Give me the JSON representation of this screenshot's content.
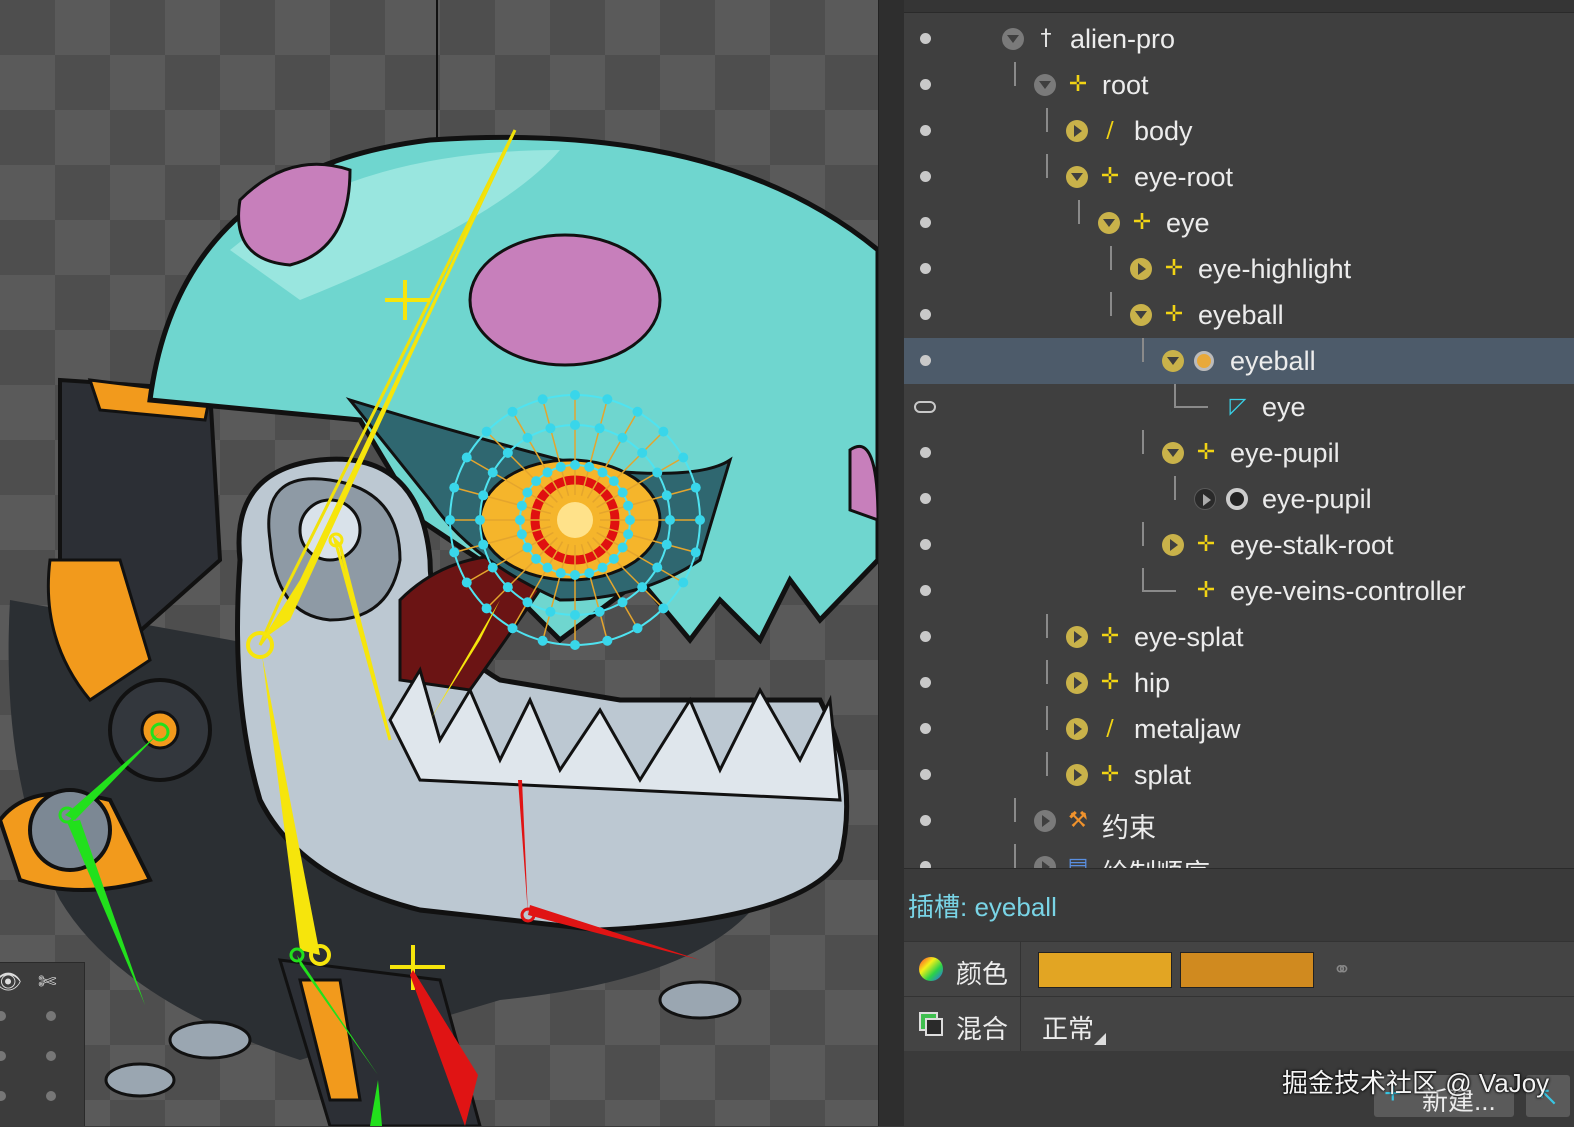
{
  "tree": {
    "rows": [
      {
        "label": "alien-pro",
        "icon": "skeleton-icon",
        "glyph": "†",
        "expander": "gray-down",
        "depth": 0
      },
      {
        "label": "root",
        "icon": "bone-icon",
        "glyph": "✛",
        "expander": "gray-down",
        "depth": 1
      },
      {
        "label": "body",
        "icon": "slot-attachment-icon",
        "glyph": "∕",
        "expander": "yellow-right",
        "depth": 2
      },
      {
        "label": "eye-root",
        "icon": "bone-icon",
        "glyph": "✛",
        "expander": "yellow-down",
        "depth": 2
      },
      {
        "label": "eye",
        "icon": "bone-icon",
        "glyph": "✛",
        "expander": "yellow-down",
        "depth": 3
      },
      {
        "label": "eye-highlight",
        "icon": "bone-icon",
        "glyph": "✛",
        "expander": "yellow-right",
        "depth": 4
      },
      {
        "label": "eyeball",
        "icon": "bone-icon",
        "glyph": "✛",
        "expander": "yellow-down",
        "depth": 4
      },
      {
        "label": "eyeball",
        "icon": "slot-icon",
        "glyph": "",
        "expander": "yellow-down",
        "depth": 5,
        "selected": true
      },
      {
        "label": "eye",
        "icon": "mesh-icon",
        "glyph": "◸",
        "expander": "none",
        "depth": 6
      },
      {
        "label": "eye-pupil",
        "icon": "bone-icon",
        "glyph": "✛",
        "expander": "yellow-down",
        "depth": 5
      },
      {
        "label": "eye-pupil",
        "icon": "slot-icon-dark",
        "glyph": "",
        "expander": "dark-right",
        "depth": 6
      },
      {
        "label": "eye-stalk-root",
        "icon": "bone-icon",
        "glyph": "✛",
        "expander": "yellow-right",
        "depth": 5
      },
      {
        "label": "eye-veins-controller",
        "icon": "bone-icon",
        "glyph": "✛",
        "expander": "none",
        "depth": 5
      },
      {
        "label": "eye-splat",
        "icon": "bone-icon",
        "glyph": "✛",
        "expander": "yellow-right",
        "depth": 2
      },
      {
        "label": "hip",
        "icon": "bone-icon",
        "glyph": "✛",
        "expander": "yellow-right",
        "depth": 2
      },
      {
        "label": "metaljaw",
        "icon": "slot-attachment-icon",
        "glyph": "∕",
        "expander": "yellow-right",
        "depth": 2
      },
      {
        "label": "splat",
        "icon": "bone-icon",
        "glyph": "✛",
        "expander": "yellow-right",
        "depth": 2
      },
      {
        "label": "约束",
        "icon": "constraint-icon",
        "glyph": "⚒",
        "expander": "gray-right",
        "depth": 1
      },
      {
        "label": "绘制顺序",
        "icon": "draw-order-icon",
        "glyph": "▤",
        "expander": "gray-right",
        "depth": 1
      }
    ]
  },
  "inspector": {
    "title": "插槽: eyeball",
    "color_label": "颜色",
    "blend_label": "混合",
    "blend_value": "正常",
    "color_light": "#e2a523",
    "color_dark": "#d08a1f",
    "new_button": "新建...",
    "watermark": "掘金技术社区 @ VaJoy"
  },
  "colors": {
    "selected_row": "#4d5b6a",
    "bone_yellow": "#f2d414",
    "accent_cyan": "#79d4e6"
  }
}
